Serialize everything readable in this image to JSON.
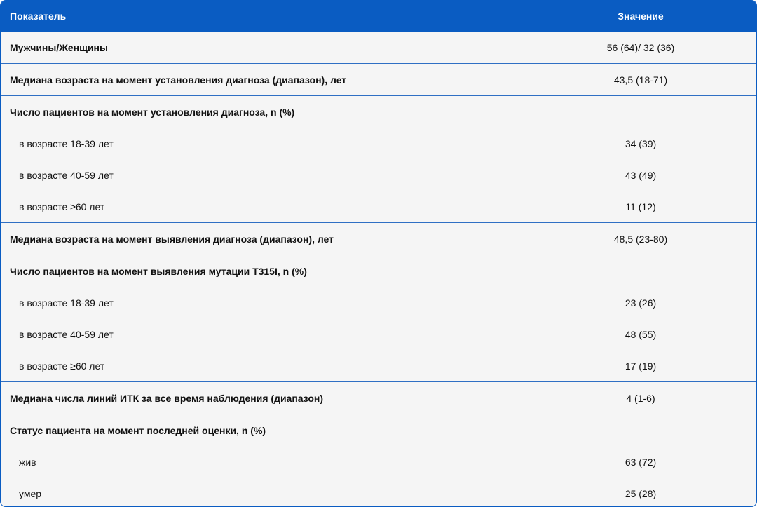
{
  "header": {
    "label": "Показатель",
    "value": "Значение"
  },
  "rows": [
    {
      "label": "Мужчины/Женщины",
      "value": "56 (64)/ 32 (36)"
    },
    {
      "label": "Медиана возраста на момент установления диагноза (диапазон), лет",
      "value": "43,5 (18-71)"
    },
    {
      "label": "Число пациентов на момент установления диагноза, n (%)",
      "value": "",
      "sub": [
        {
          "label": "в возрасте 18-39 лет",
          "value": "34 (39)"
        },
        {
          "label": "в возрасте 40-59 лет",
          "value": "43 (49)"
        },
        {
          "label": "в возрасте  ≥60 лет",
          "value": "11 (12)"
        }
      ]
    },
    {
      "label": "Медиана возраста на момент выявления диагноза (диапазон), лет",
      "value": "48,5 (23-80)"
    },
    {
      "label": "Число пациентов на момент выявления мутации T315I, n (%)",
      "value": "",
      "sub": [
        {
          "label": "в возрасте 18-39 лет",
          "value": "23 (26)"
        },
        {
          "label": "в возрасте 40-59 лет",
          "value": "48 (55)"
        },
        {
          "label": "в возрасте  ≥60 лет",
          "value": "17 (19)"
        }
      ]
    },
    {
      "label": "Медиана числа линий ИТК за все время наблюдения (диапазон)",
      "value": "4 (1-6)"
    },
    {
      "label": "Статус пациента на момент последней оценки, n (%)",
      "value": "",
      "sub": [
        {
          "label": "жив",
          "value": "63 (72)"
        },
        {
          "label": "умер",
          "value": "25 (28)"
        }
      ]
    }
  ]
}
